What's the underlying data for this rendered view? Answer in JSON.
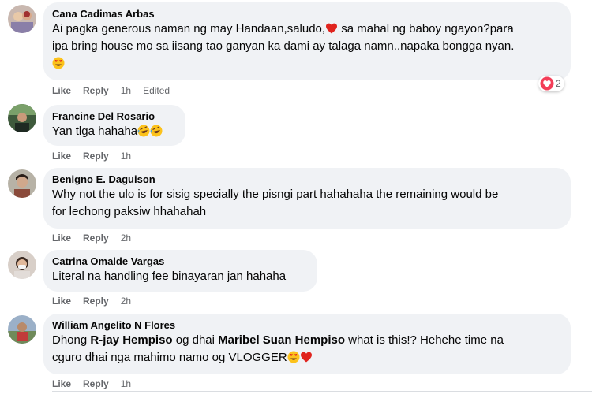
{
  "colors": {
    "bubble": "#f0f2f5",
    "action_text": "#65676b",
    "heart": "#f02849"
  },
  "comments": [
    {
      "author": "Cana Cadimas Arbas",
      "text_a": "Ai pagka generous naman ng may Handaan,saludo,",
      "text_b": " sa mahal ng baboy ngayon?para",
      "text_c": "ipa bring house mo sa iisang tao ganyan ka dami ay talaga namn..napaka bongga nyan.",
      "like": "Like",
      "reply": "Reply",
      "time": "1h",
      "edited": "Edited",
      "reaction_count": "2",
      "emoji": [
        "heart-icon",
        "heart-eyes-icon"
      ]
    },
    {
      "author": "Francine Del Rosario",
      "text_a": "Yan tlga hahaha",
      "like": "Like",
      "reply": "Reply",
      "time": "1h",
      "emoji": [
        "rofl-icon",
        "rofl-icon"
      ]
    },
    {
      "author": "Benigno E. Daguison",
      "text_a": "Why not the ulo is for sisig specially the pisngi part hahahaha the remaining would be",
      "text_b": "for lechong paksiw hhahahah",
      "like": "Like",
      "reply": "Reply",
      "time": "2h"
    },
    {
      "author": "Catrina Omalde Vargas",
      "text_a": "Literal na handling fee binayaran jan hahaha",
      "like": "Like",
      "reply": "Reply",
      "time": "2h"
    },
    {
      "author": "William Angelito N Flores",
      "text_a": "Dhong ",
      "mention_1": "R-jay Hempiso",
      "text_b": " og dhai ",
      "mention_2": "Maribel Suan Hempiso",
      "text_c": " what is this!? Hehehe time na",
      "text_d": "cguro dhai nga mahimo namo og VLOGGER",
      "like": "Like",
      "reply": "Reply",
      "time": "1h",
      "emoji": [
        "heart-eyes-icon",
        "heart-icon"
      ]
    }
  ]
}
